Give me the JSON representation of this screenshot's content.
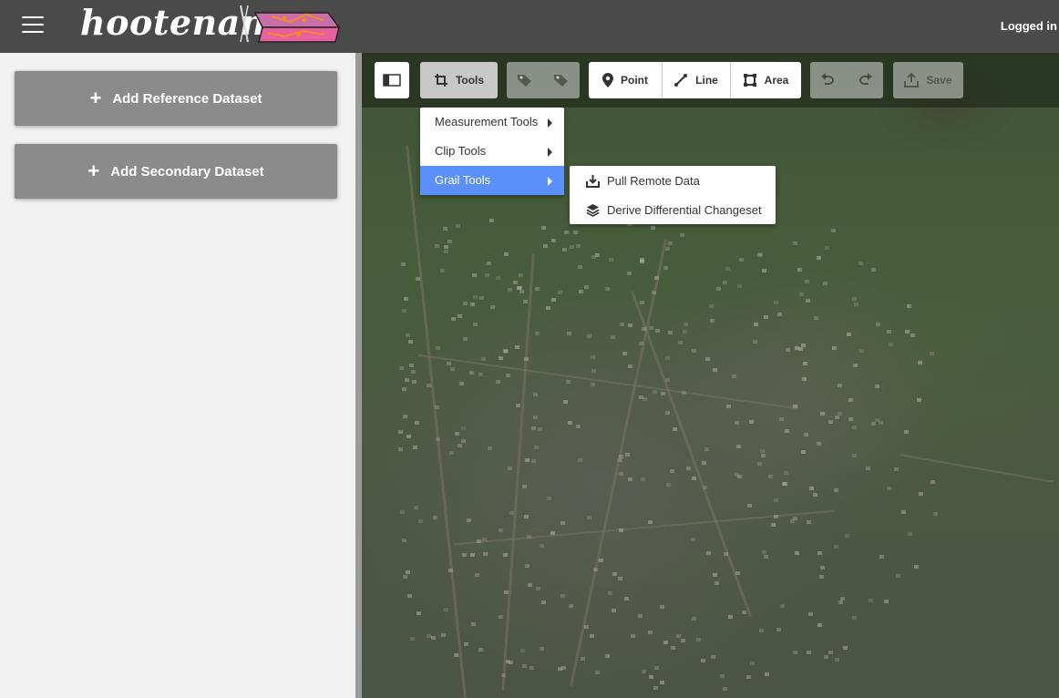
{
  "header": {
    "app_name": "hootenanny",
    "user_status": "Logged in"
  },
  "sidebar": {
    "add_reference_label": "Add Reference Dataset",
    "add_secondary_label": "Add Secondary Dataset",
    "plus_glyph": "+"
  },
  "toolbar": {
    "tools_label": "Tools",
    "point_label": "Point",
    "line_label": "Line",
    "area_label": "Area",
    "save_label": "Save"
  },
  "tools_menu": {
    "items": [
      {
        "label": "Measurement Tools"
      },
      {
        "label": "Clip Tools"
      },
      {
        "label": "Grail Tools"
      }
    ],
    "active_item": "Grail Tools"
  },
  "grail_submenu": {
    "items": [
      {
        "label": "Pull Remote Data",
        "icon": "download-icon"
      },
      {
        "label": "Derive Differential Changeset",
        "icon": "layers-icon"
      }
    ]
  },
  "colors": {
    "header_bg": "#4a4a4a",
    "dataset_button_bg": "#8b8b8b",
    "menu_active_bg": "#5b8ff9"
  }
}
